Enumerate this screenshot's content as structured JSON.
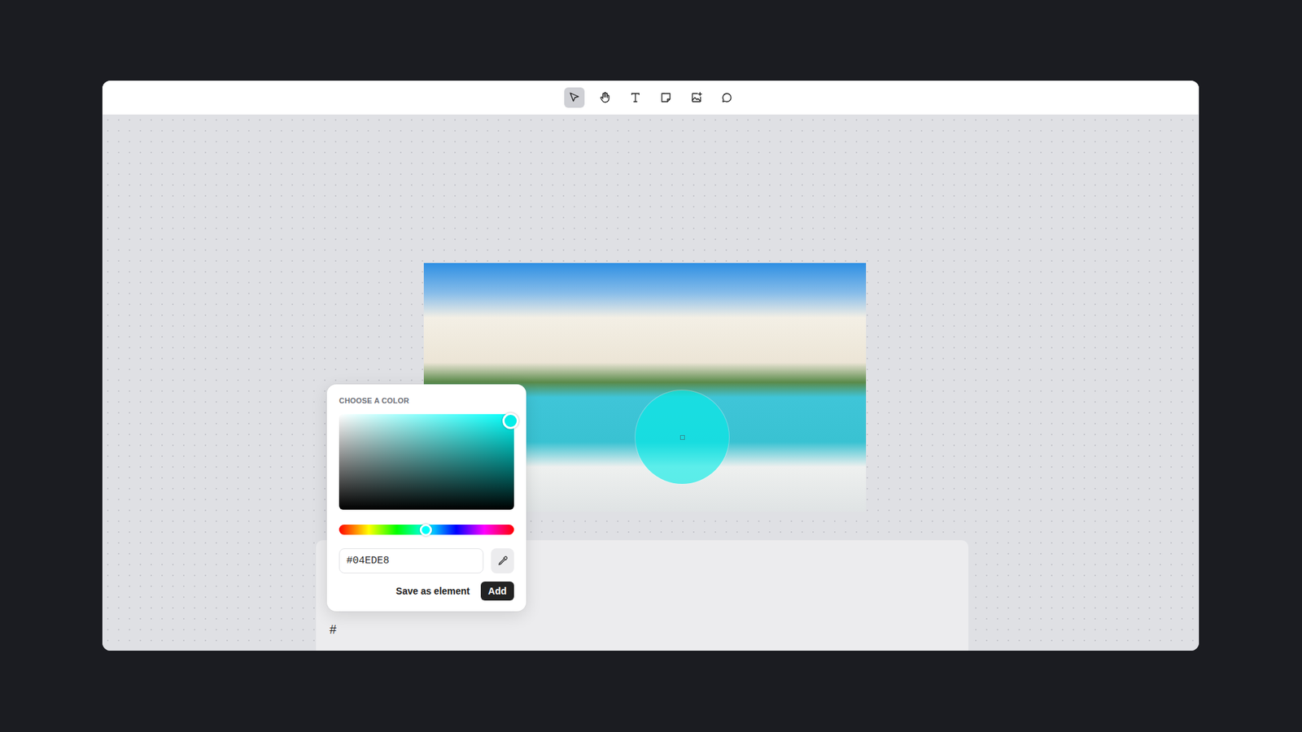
{
  "toolbar": {
    "tools": [
      {
        "kind": "pointer",
        "selected": true
      },
      {
        "kind": "hand",
        "selected": false
      },
      {
        "kind": "text",
        "selected": false
      },
      {
        "kind": "note",
        "selected": false
      },
      {
        "kind": "image",
        "selected": false
      },
      {
        "kind": "comment",
        "selected": false
      }
    ]
  },
  "canvas": {
    "shape": {
      "kind": "circle",
      "selected": true
    }
  },
  "color_picker": {
    "title": "CHOOSE A COLOR",
    "saturation": 0.98,
    "brightness": 0.93,
    "hue": {
      "level": 0.497
    },
    "hex": "#04EDE8",
    "buttons": [
      {
        "label": "Save as element",
        "kind": "text"
      },
      {
        "label": "Add",
        "kind": "primary"
      }
    ]
  },
  "bottom_panel": {
    "text": "#"
  }
}
